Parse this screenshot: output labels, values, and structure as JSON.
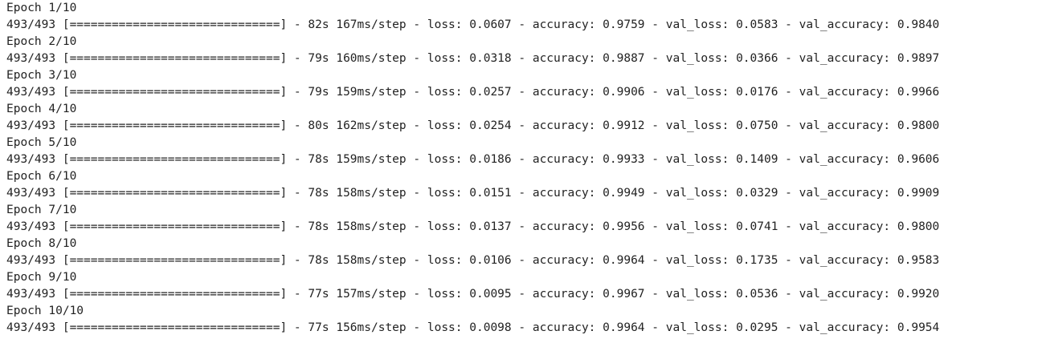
{
  "training_log": {
    "epochs": [
      {
        "header": "Epoch 1/10",
        "steps": "493/493",
        "bar": "[==============================]",
        "time": "82s",
        "step_time": "167ms/step",
        "loss": "0.0607",
        "accuracy": "0.9759",
        "val_loss": "0.0583",
        "val_accuracy": "0.9840"
      },
      {
        "header": "Epoch 2/10",
        "steps": "493/493",
        "bar": "[==============================]",
        "time": "79s",
        "step_time": "160ms/step",
        "loss": "0.0318",
        "accuracy": "0.9887",
        "val_loss": "0.0366",
        "val_accuracy": "0.9897"
      },
      {
        "header": "Epoch 3/10",
        "steps": "493/493",
        "bar": "[==============================]",
        "time": "79s",
        "step_time": "159ms/step",
        "loss": "0.0257",
        "accuracy": "0.9906",
        "val_loss": "0.0176",
        "val_accuracy": "0.9966"
      },
      {
        "header": "Epoch 4/10",
        "steps": "493/493",
        "bar": "[==============================]",
        "time": "80s",
        "step_time": "162ms/step",
        "loss": "0.0254",
        "accuracy": "0.9912",
        "val_loss": "0.0750",
        "val_accuracy": "0.9800"
      },
      {
        "header": "Epoch 5/10",
        "steps": "493/493",
        "bar": "[==============================]",
        "time": "78s",
        "step_time": "159ms/step",
        "loss": "0.0186",
        "accuracy": "0.9933",
        "val_loss": "0.1409",
        "val_accuracy": "0.9606"
      },
      {
        "header": "Epoch 6/10",
        "steps": "493/493",
        "bar": "[==============================]",
        "time": "78s",
        "step_time": "158ms/step",
        "loss": "0.0151",
        "accuracy": "0.9949",
        "val_loss": "0.0329",
        "val_accuracy": "0.9909"
      },
      {
        "header": "Epoch 7/10",
        "steps": "493/493",
        "bar": "[==============================]",
        "time": "78s",
        "step_time": "158ms/step",
        "loss": "0.0137",
        "accuracy": "0.9956",
        "val_loss": "0.0741",
        "val_accuracy": "0.9800"
      },
      {
        "header": "Epoch 8/10",
        "steps": "493/493",
        "bar": "[==============================]",
        "time": "78s",
        "step_time": "158ms/step",
        "loss": "0.0106",
        "accuracy": "0.9964",
        "val_loss": "0.1735",
        "val_accuracy": "0.9583"
      },
      {
        "header": "Epoch 9/10",
        "steps": "493/493",
        "bar": "[==============================]",
        "time": "77s",
        "step_time": "157ms/step",
        "loss": "0.0095",
        "accuracy": "0.9967",
        "val_loss": "0.0536",
        "val_accuracy": "0.9920"
      },
      {
        "header": "Epoch 10/10",
        "steps": "493/493",
        "bar": "[==============================]",
        "time": "77s",
        "step_time": "156ms/step",
        "loss": "0.0098",
        "accuracy": "0.9964",
        "val_loss": "0.0295",
        "val_accuracy": "0.9954"
      }
    ],
    "labels": {
      "separator": " - ",
      "loss": "loss: ",
      "accuracy": "accuracy: ",
      "val_loss": "val_loss: ",
      "val_accuracy": "val_accuracy: "
    },
    "colors": {
      "text": "#222222",
      "background": "#ffffff"
    }
  }
}
